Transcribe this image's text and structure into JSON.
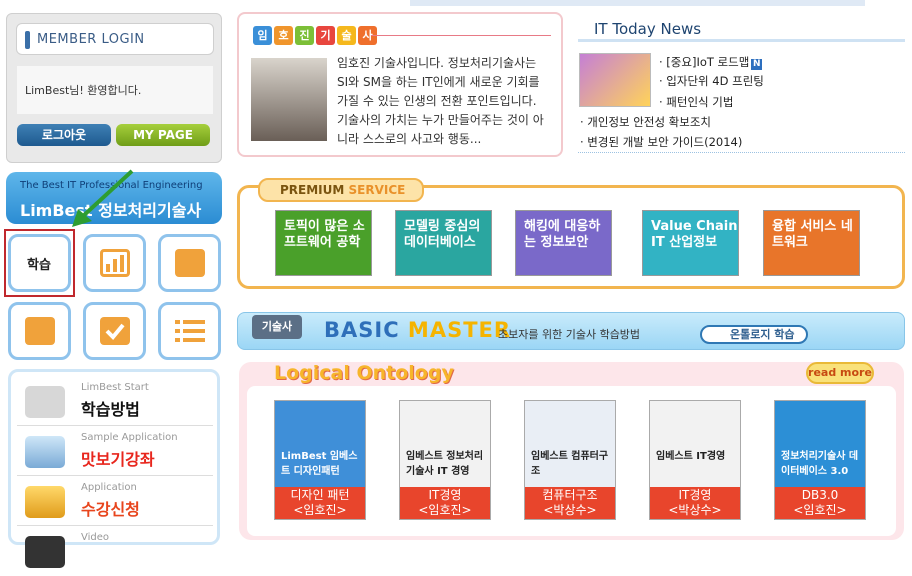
{
  "login": {
    "title": "MEMBER LOGIN",
    "welcome": "LimBest님! 환영합니다.",
    "logout": "로그아웃",
    "mypage": "MY PAGE"
  },
  "banner": {
    "sub": "The Best IT Professional Engineering",
    "title": "LimBest 정보처리기술사"
  },
  "tiles": {
    "study": "학습"
  },
  "menu": [
    {
      "sub": "LimBest Start",
      "main": "학습방법",
      "color": "#111111"
    },
    {
      "sub": "Sample Application",
      "main": "맛보기강좌",
      "color": "#e8261d"
    },
    {
      "sub": "Application",
      "main": "수강신청",
      "color": "#e8451d"
    },
    {
      "sub": "Video",
      "main": "",
      "color": "#111111"
    }
  ],
  "intro": {
    "tags": [
      "임",
      "호",
      "진",
      "기",
      "술",
      "사"
    ],
    "text": "임호진 기술사입니다. 정보처리기술사는 SI와 SM을 하는 IT인에게 새로운 기회를 가질 수 있는 인생의 전환 포인트입니다. 기술사의 가치는 누가 만들어주는 것이 아니라 스스로의 사고와 행동..."
  },
  "news": {
    "title": "IT Today News",
    "items": [
      "· [중요]IoT 로드맵",
      "· 입자단위 4D 프린팅",
      "· 패턴인식 기법",
      "· 개인정보 안전성 확보조치",
      "· 변경된 개발 보안 가이드(2014)"
    ],
    "new_badge": "N"
  },
  "premium": {
    "label_a": "PREMIUM",
    "label_b": "SERVICE",
    "items": [
      {
        "text": "토픽이 많은 소프트웨어 공학",
        "color": "#4aa02a"
      },
      {
        "text": "모델링 중심의 데이터베이스",
        "color": "#2aa6a0"
      },
      {
        "text": "해킹에 대응하는 정보보안",
        "color": "#7a69c9"
      },
      {
        "text": "Value Chain IT 산업정보",
        "color": "#32b3c4"
      },
      {
        "text": "융합 서비스 네트워크",
        "color": "#e8752a"
      }
    ]
  },
  "basic": {
    "tag": "기술사",
    "title_a": "BASIC",
    "title_b": "MASTER",
    "sub": "초보자를 위한 기술사 학습방법",
    "btn": "온톨로지 학습"
  },
  "ontology": {
    "title": "Logical Ontology",
    "more": "read more",
    "books": [
      {
        "cover_title": "LimBest 임베스트 디자인패턴",
        "cap1": "디자인 패턴",
        "cap2": "<임호진>",
        "color": "#3f8fd8"
      },
      {
        "cover_title": "임베스트 정보처리기술사 IT 경영",
        "cap1": "IT경영",
        "cap2": "<임호진>",
        "color": "#f2f2f2"
      },
      {
        "cover_title": "임베스트 컴퓨터구조",
        "cap1": "컴퓨터구조",
        "cap2": "<박상수>",
        "color": "#e9eef5"
      },
      {
        "cover_title": "임베스트 IT경영",
        "cap1": "IT경영",
        "cap2": "<박상수>",
        "color": "#f2f2f2"
      },
      {
        "cover_title": "정보처리기술사 데이터베이스 3.0",
        "cap1": "DB3.0",
        "cap2": "<임호진>",
        "color": "#2c8fd6"
      }
    ]
  }
}
